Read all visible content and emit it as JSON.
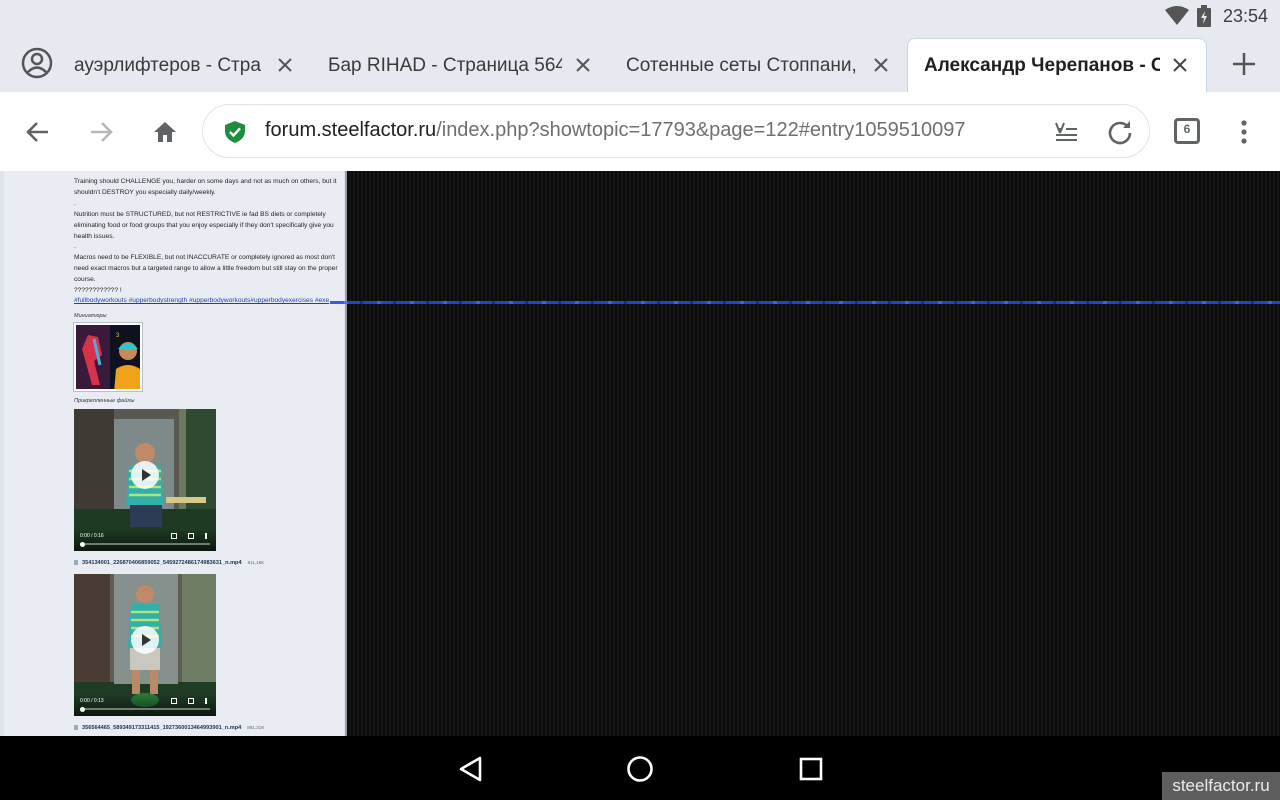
{
  "status_bar": {
    "time": "23:54"
  },
  "tabs": [
    {
      "title": "ауэрлифтеров - Стра",
      "active": false
    },
    {
      "title": "Бар RIHAD - Страница 564",
      "active": false
    },
    {
      "title": "Сотенные сеты Стоппани,",
      "active": false
    },
    {
      "title": "Александр Черепанов - Ст",
      "active": true
    }
  ],
  "toolbar": {
    "url_host": "forum.steelfactor.ru",
    "url_path": "/index.php?showtopic=17793&page=122#entry1059510097",
    "tab_count": "6"
  },
  "post": {
    "paragraphs": [
      "Training should CHALLENGE you, harder on some days and not as much on others, but it shouldn't DESTROY you especially daily/weekly.",
      ".",
      "Nutrition must be STRUCTURED, but not RESTRICTIVE ie fad BS diets or completely eliminating food or food groups that you enjoy especially if they don't specifically give you health issues.",
      ".",
      "Macros need to be FLEXIBLE, but not INACCURATE or completely ignored as most don't need exact macros but a targeted range to allow a little freedom but still stay on the proper course.",
      "???????????? !"
    ],
    "hashtags": "#fullbodyworkouts #upperbodystrength #upperbodyworkouts#upperbodyexercises #exe",
    "thumbnails_label": "Миниатюры",
    "attachments_label": "Прикрепленные файлы",
    "videos": [
      {
        "time": "0:00 / 0:16",
        "file_name": "354134001_226870406859052_5459272486174983631_n.mp4",
        "file_size": "811,16K"
      },
      {
        "time": "0:00 / 0:13",
        "file_name": "356564465_589349173311415_1927360013464993901_n.mp4",
        "file_size": "881,31K"
      }
    ]
  },
  "watermark": "steelfactor.ru",
  "colors": {
    "chrome_bg": "#e6eaf0",
    "secure_green": "#1e8e3e",
    "link_blue": "#1a3fb0"
  }
}
